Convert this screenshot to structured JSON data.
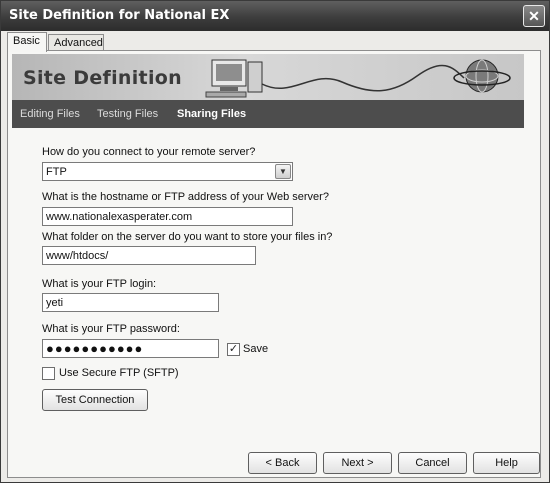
{
  "window": {
    "title": "Site Definition for National EX",
    "close_glyph": "✕"
  },
  "tabs": [
    {
      "label": "Basic"
    },
    {
      "label": "Advanced"
    }
  ],
  "banner": {
    "title": "Site Definition"
  },
  "subnav": [
    {
      "label": "Editing Files"
    },
    {
      "label": "Testing Files"
    },
    {
      "label": "Sharing Files"
    }
  ],
  "form": {
    "connect_question": "How do you connect to your remote server?",
    "connect_value": "FTP",
    "host_question": "What is the hostname or FTP address of your Web server?",
    "host_value": "www.nationalexasperater.com",
    "folder_question": "What folder on the server do you want to store your files in?",
    "folder_value": "www/htdocs/",
    "login_question": "What is your FTP login:",
    "login_value": "yeti",
    "password_question": "What is your FTP password:",
    "password_value": "●●●●●●●●●●●",
    "save_label": "Save",
    "save_checked": true,
    "sftp_label": "Use Secure FTP (SFTP)",
    "sftp_checked": false,
    "test_button": "Test Connection"
  },
  "buttons": {
    "back": "< Back",
    "next": "Next >",
    "cancel": "Cancel",
    "help": "Help"
  }
}
